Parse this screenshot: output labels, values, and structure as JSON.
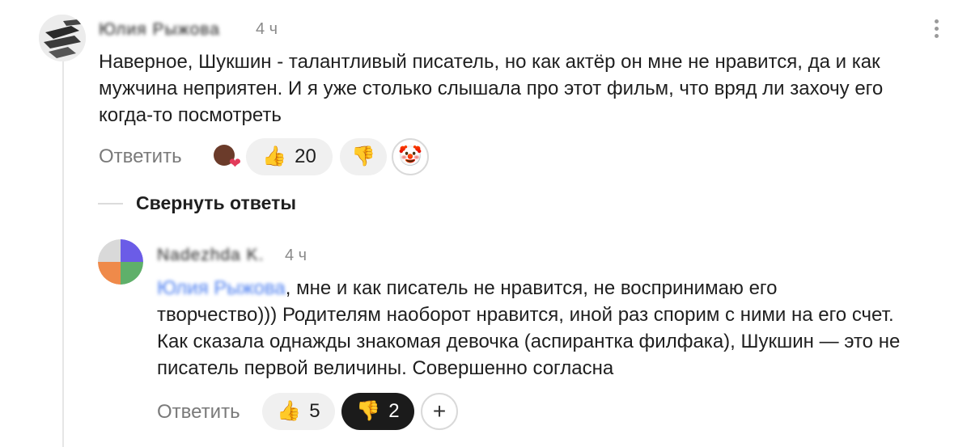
{
  "comment": {
    "author": "Юлия Рыжова",
    "time": "4 ч",
    "text": "Наверное, Шукшин - талантливый писатель, но как актёр он мне не нравится, да и как мужчина неприятен. И я уже столько слышала про этот фильм, что вряд ли захочу его когда-то посмотреть",
    "reply_label": "Ответить",
    "reactions": [
      {
        "icon": "heart-avatar-icon",
        "glyph": "❤",
        "count": ""
      },
      {
        "icon": "thumbs-up-icon",
        "glyph": "👍",
        "count": "20"
      },
      {
        "icon": "thumbs-down-icon",
        "glyph": "👎",
        "count": ""
      },
      {
        "icon": "clown-icon",
        "glyph": "🤡",
        "count": ""
      }
    ]
  },
  "collapse_label": "Свернуть ответы",
  "reply_comment": {
    "author": "Nadezhda K.",
    "time": "4 ч",
    "mention": "Юлия Рыжова",
    "text": ", мне и как писатель не нравится, не воспринимаю его творчество))) Родителям наоборот нравится, иной раз спорим с ними на его счет. Как сказала однажды знакомая девочка (аспирантка филфака), Шукшин — это не писатель первой величины. Совершенно согласна",
    "reply_label": "Ответить",
    "like_glyph": "👍",
    "like_count": "5",
    "dislike_glyph": "👎",
    "dislike_count": "2",
    "add_glyph": "+"
  },
  "colors": {
    "mention": "#4a7df0",
    "pill_bg": "#f0f0f0",
    "pill_active": "#1b1b1b"
  }
}
